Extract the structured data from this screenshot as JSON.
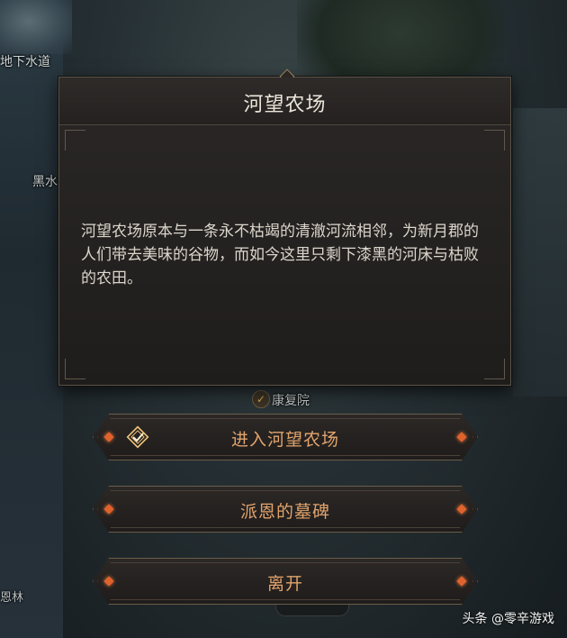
{
  "map_labels": {
    "sewer": "地下水道",
    "black_water": "黑水",
    "hospital": "康复院",
    "forest": "恩林"
  },
  "dialog": {
    "title": "河望农场",
    "body": "河望农场原本与一条永不枯竭的清澈河流相邻，为新月郡的人们带去美味的谷物，而如今这里只剩下漆黑的河床与枯败的农田。"
  },
  "choices": [
    {
      "label": "进入河望农场",
      "icon": "quest-enter-icon"
    },
    {
      "label": "派恩的墓碑"
    },
    {
      "label": "离开"
    }
  ],
  "watermark": "头条 @零辛游戏",
  "colors": {
    "choice_text": "#e2a46c",
    "gem": "#e0622c"
  }
}
